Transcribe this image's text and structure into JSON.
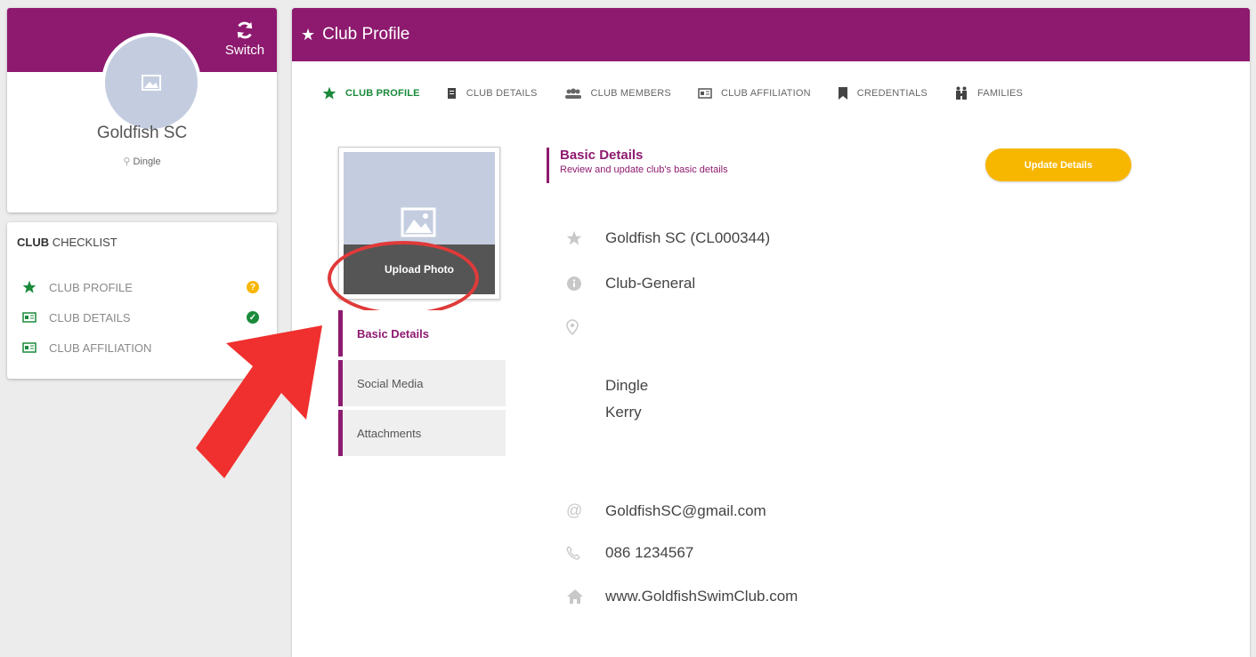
{
  "club_card": {
    "switch_label": "Switch",
    "name": "Goldfish SC",
    "location": "Dingle"
  },
  "checklist": {
    "heading_bold": "CLUB",
    "heading_rest": " CHECKLIST",
    "items": [
      {
        "label": "CLUB PROFILE",
        "status": "?"
      },
      {
        "label": "CLUB DETAILS",
        "status": "✓"
      },
      {
        "label": "CLUB AFFILIATION",
        "status": ""
      }
    ]
  },
  "header": {
    "title": "Club Profile"
  },
  "tabs": [
    {
      "label": "CLUB PROFILE"
    },
    {
      "label": "CLUB DETAILS"
    },
    {
      "label": "CLUB MEMBERS"
    },
    {
      "label": "CLUB AFFILIATION"
    },
    {
      "label": "CREDENTIALS"
    },
    {
      "label": "FAMILIES"
    }
  ],
  "photo": {
    "upload_label": "Upload Photo"
  },
  "side_tabs": [
    {
      "label": "Basic Details"
    },
    {
      "label": "Social Media"
    },
    {
      "label": "Attachments"
    }
  ],
  "details": {
    "section_title": "Basic Details",
    "section_subtitle": "Review and update club's basic details",
    "update_label": "Update Details",
    "club_name_code": "Goldfish SC (CL000344)",
    "club_type": "Club-General",
    "address_line1": "Dingle",
    "address_line2": "Kerry",
    "email": "GoldfishSC@gmail.com",
    "phone": "086 1234567",
    "website": "www.GoldfishSwimClub.com"
  },
  "colors": {
    "brand": "#8e1a6f",
    "accent": "#f7b600",
    "success": "#1a8a3a",
    "annotation": "#e03a3a"
  }
}
